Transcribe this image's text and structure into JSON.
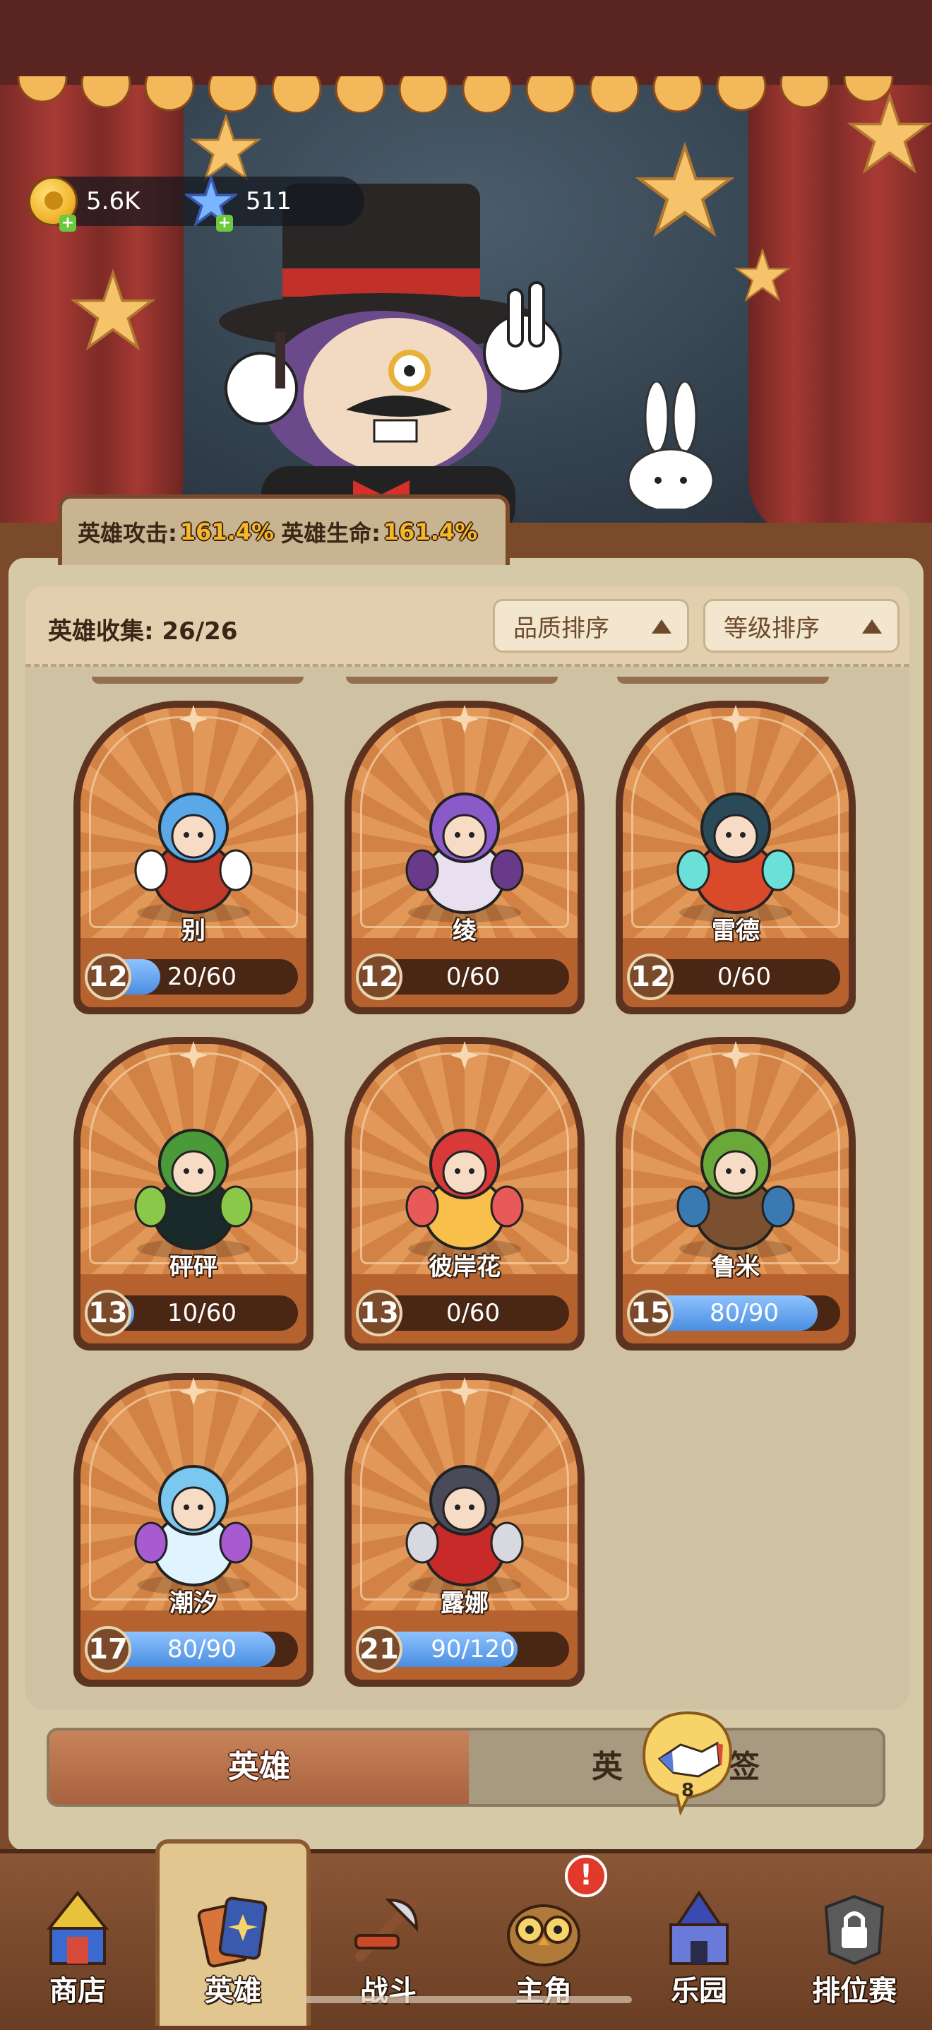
{
  "currency": {
    "coins": "5.6K",
    "gems": "511"
  },
  "buff": {
    "attack_label": "英雄攻击:",
    "attack_value": "161.4%",
    "hp_label": "英雄生命:",
    "hp_value": "161.4%"
  },
  "collection": {
    "label": "英雄收集: 26/26"
  },
  "sort": {
    "quality": "品质排序",
    "level": "等级排序"
  },
  "heroes": [
    {
      "name": "别",
      "level": "12",
      "progress": "20/60",
      "fill": 0.333
    },
    {
      "name": "绫",
      "level": "12",
      "progress": "0/60",
      "fill": 0
    },
    {
      "name": "雷德",
      "level": "12",
      "progress": "0/60",
      "fill": 0
    },
    {
      "name": "砰砰",
      "level": "13",
      "progress": "10/60",
      "fill": 0.167
    },
    {
      "name": "彼岸花",
      "level": "13",
      "progress": "0/60",
      "fill": 0
    },
    {
      "name": "鲁米",
      "level": "15",
      "progress": "80/90",
      "fill": 0.889
    },
    {
      "name": "潮汐",
      "level": "17",
      "progress": "80/90",
      "fill": 0.889
    },
    {
      "name": "露娜",
      "level": "21",
      "progress": "90/120",
      "fill": 0.75
    }
  ],
  "tabs": {
    "heroes": "英雄",
    "bonds_prefix": "英",
    "bonds_suffix": "签",
    "bonds_badge": "8"
  },
  "nav": {
    "items": [
      {
        "label": "商店",
        "icon": "shop-tent-icon"
      },
      {
        "label": "英雄",
        "icon": "hero-cards-icon"
      },
      {
        "label": "战斗",
        "icon": "battle-weapons-icon"
      },
      {
        "label": "主角",
        "icon": "owl-hero-icon"
      },
      {
        "label": "乐园",
        "icon": "castle-park-icon"
      },
      {
        "label": "排位赛",
        "icon": "locked-ranked-icon"
      }
    ],
    "alert": "!"
  },
  "colors": {
    "progress_fill": "#4a8ee0",
    "gold_text": "#f5b82a",
    "alert": "#e23a2a",
    "card_bg": "#d98e4e"
  }
}
